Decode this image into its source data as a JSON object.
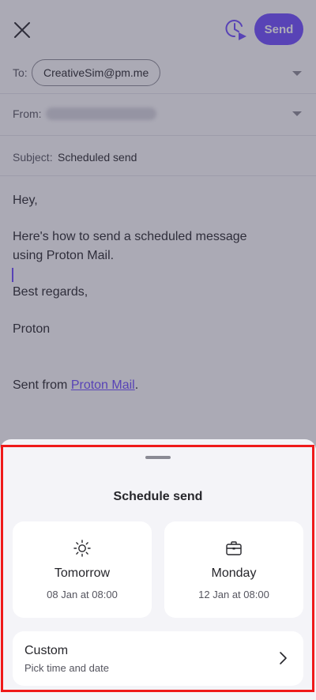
{
  "compose": {
    "send_label": "Send",
    "to_label": "To:",
    "to_recipient": "CreativeSim@pm.me",
    "from_label": "From:",
    "subject_label": "Subject:",
    "subject_value": "Scheduled send",
    "body": {
      "greeting": "Hey,",
      "line1": "Here's how to send a scheduled message",
      "line2": "using Proton Mail.",
      "closing": "Best regards,",
      "signature": "Proton",
      "sent_from_prefix": "Sent from ",
      "sent_from_link": "Proton Mail",
      "sent_from_suffix": "."
    }
  },
  "sheet": {
    "title": "Schedule send",
    "options": [
      {
        "title": "Tomorrow",
        "subtitle": "08 Jan at 08:00",
        "icon": "sun-icon"
      },
      {
        "title": "Monday",
        "subtitle": "12 Jan at 08:00",
        "icon": "briefcase-icon"
      }
    ],
    "custom": {
      "title": "Custom",
      "subtitle": "Pick time and date",
      "icon": "chevron-right-icon"
    }
  },
  "colors": {
    "accent": "#6d4aff",
    "highlight_border": "#ef1a1a",
    "sheet_background": "#f4f4f8",
    "overlay": "rgba(60,58,82,0.42)"
  }
}
